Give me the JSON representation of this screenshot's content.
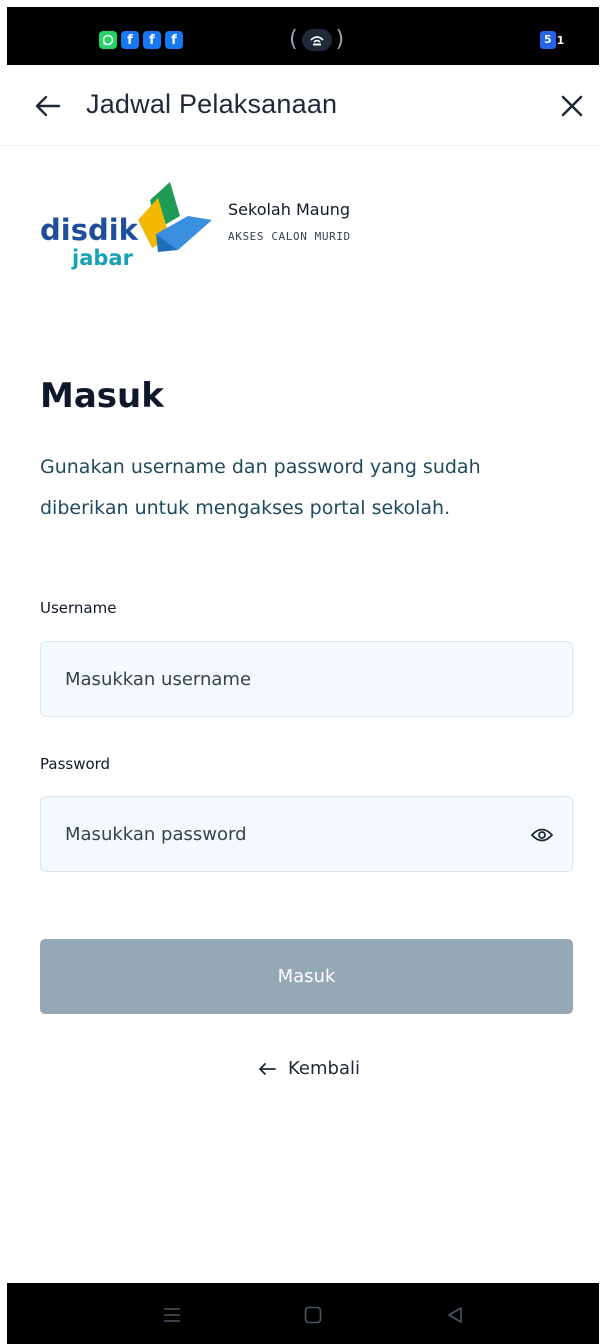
{
  "status_bar": {
    "notifications": [
      {
        "icon": "whatsapp-icon",
        "glyph": "◎",
        "color": "#25d366"
      },
      {
        "icon": "facebook-icon",
        "glyph": "f",
        "color": "#1877f2"
      },
      {
        "icon": "facebook-icon",
        "glyph": "f",
        "color": "#1877f2"
      },
      {
        "icon": "facebook-icon",
        "glyph": "f",
        "color": "#1877f2"
      }
    ],
    "battery_level": "5",
    "battery_suffix": "1"
  },
  "header": {
    "title": "Jadwal Pelaksanaan",
    "back_icon": "arrow-left-icon",
    "close_icon": "close-icon"
  },
  "brand": {
    "logo_line1": "disdik",
    "logo_line2": "jabar",
    "name": "Sekolah Maung",
    "subtitle": "AKSES CALON MURID"
  },
  "login": {
    "title": "Masuk",
    "description": "Gunakan username dan password yang sudah diberikan untuk mengakses portal sekolah.",
    "username_label": "Username",
    "username_placeholder": "Masukkan username",
    "username_value": "",
    "password_label": "Password",
    "password_placeholder": "Masukkan password",
    "password_value": "",
    "submit_label": "Masuk",
    "back_label": "Kembali"
  },
  "colors": {
    "submit_bg": "#95a8b5",
    "input_bg": "#f4f9fd",
    "logo_blue": "#1e6fb8",
    "logo_teal": "#17a2b8",
    "logo_yellow": "#f2b900",
    "logo_green": "#1e9b57",
    "logo_lightblue": "#3b8fe0"
  }
}
